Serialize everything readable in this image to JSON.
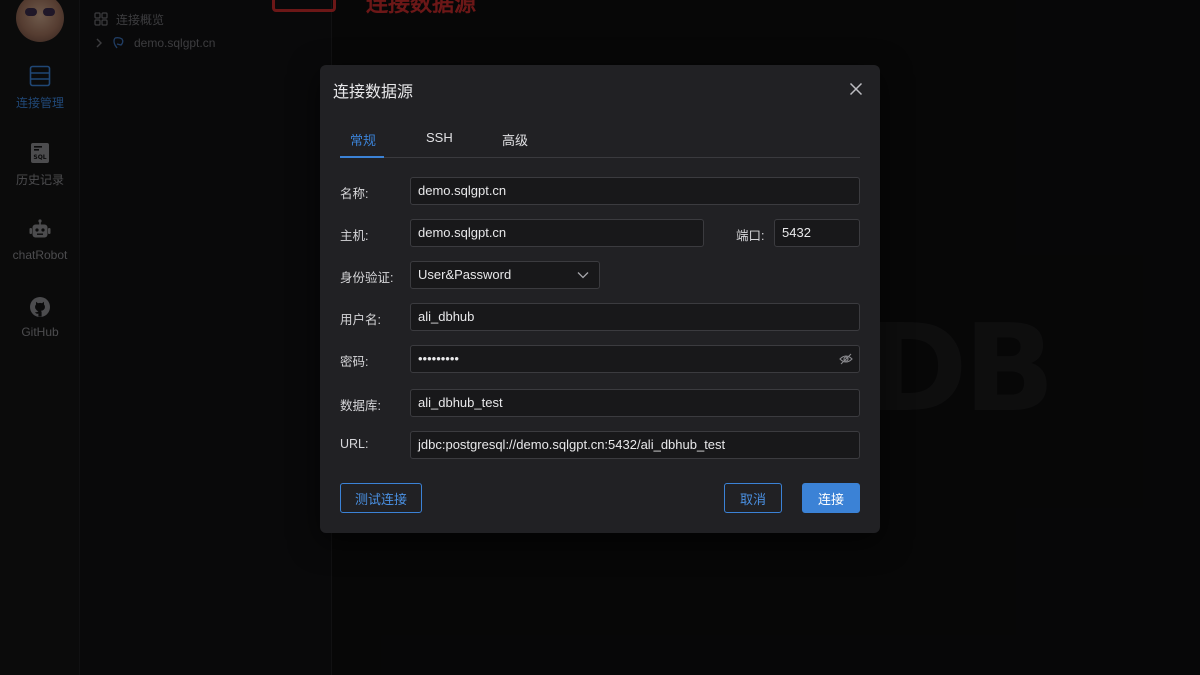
{
  "annotation": {
    "text": "连接数据源",
    "color": "#c52b2b"
  },
  "sidebar": {
    "items": [
      {
        "label": "连接管理",
        "icon": "database-stack-icon",
        "active": true
      },
      {
        "label": "历史记录",
        "icon": "sql-file-icon",
        "active": false
      },
      {
        "label": "chatRobot",
        "icon": "robot-icon",
        "active": false
      },
      {
        "label": "GitHub",
        "icon": "github-icon",
        "active": false
      }
    ]
  },
  "tree": {
    "overview_label": "连接概览",
    "connection_label": "demo.sqlgpt.cn"
  },
  "background": {
    "logo_text": "DB"
  },
  "modal": {
    "title": "连接数据源",
    "tabs": [
      {
        "label": "常规",
        "active": true
      },
      {
        "label": "SSH",
        "active": false
      },
      {
        "label": "高级",
        "active": false
      }
    ],
    "fields": {
      "name": {
        "label": "名称:",
        "value": "demo.sqlgpt.cn"
      },
      "host": {
        "label": "主机:",
        "value": "demo.sqlgpt.cn"
      },
      "port": {
        "label": "端口:",
        "value": "5432"
      },
      "auth": {
        "label": "身份验证:",
        "value": "User&Password"
      },
      "username": {
        "label": "用户名:",
        "value": "ali_dbhub"
      },
      "password": {
        "label": "密码:",
        "value": "•••••••••"
      },
      "database": {
        "label": "数据库:",
        "value": "ali_dbhub_test"
      },
      "url": {
        "label": "URL:",
        "value": "jdbc:postgresql://demo.sqlgpt.cn:5432/ali_dbhub_test"
      }
    },
    "buttons": {
      "test": "测试连接",
      "cancel": "取消",
      "connect": "连接"
    }
  },
  "colors": {
    "accent": "#3b82d6",
    "annotation": "#c52b2b",
    "modal_bg": "#212124"
  }
}
